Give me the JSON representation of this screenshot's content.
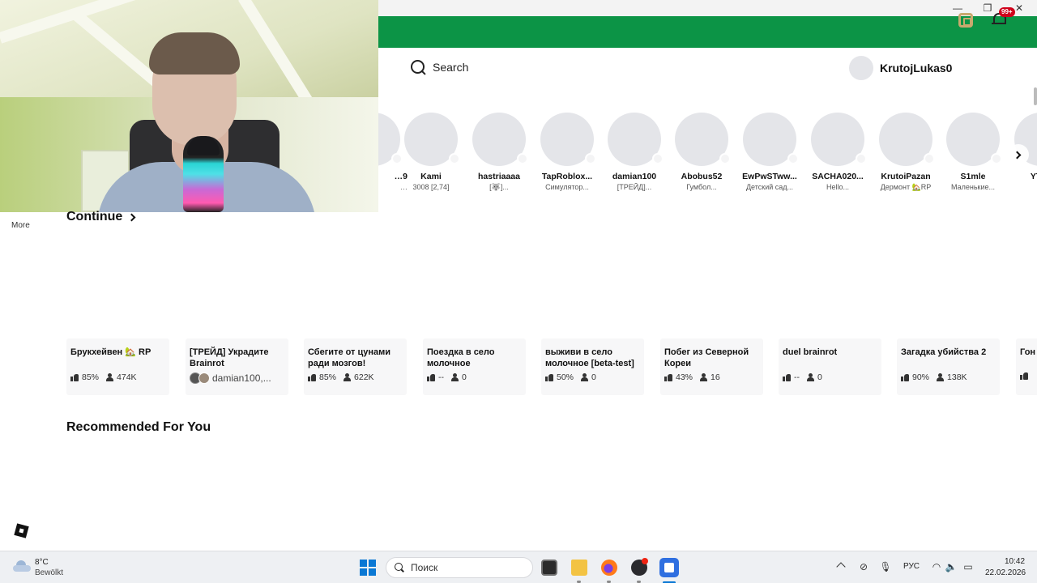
{
  "window": {
    "minimize": "—",
    "maximize": "❐",
    "close": "✕"
  },
  "header": {
    "search_label": "Search",
    "username": "KrutojLukas0",
    "notification_badge": "99+"
  },
  "friends": [
    {
      "name": "…9",
      "sub": "…"
    },
    {
      "name": "Kami",
      "sub": "3008 [2,74]"
    },
    {
      "name": "hastriaaaa",
      "sub": "[🐺]..."
    },
    {
      "name": "TapRoblox...",
      "sub": "Симулятор..."
    },
    {
      "name": "damian100",
      "sub": "[ТРЕЙД]..."
    },
    {
      "name": "Abobus52",
      "sub": "Гумбол..."
    },
    {
      "name": "EwPwSTww...",
      "sub": "Детский сад..."
    },
    {
      "name": "SACHA020...",
      "sub": "Hello..."
    },
    {
      "name": "KrutoiPazan",
      "sub": "Дермонт 🏡RP"
    },
    {
      "name": "S1mle",
      "sub": "Маленькие..."
    },
    {
      "name": "YTLo",
      "sub": "[..."
    }
  ],
  "left_nav": {
    "more_label": "More"
  },
  "continue": {
    "title": "Continue",
    "games": [
      {
        "name": "Брукхейвен 🏡 RP",
        "rating": "85%",
        "players": "474K",
        "type": "stats"
      },
      {
        "name": "[ТРЕЙД] Украдите Brainrot",
        "creator": "damian100,...",
        "type": "creator"
      },
      {
        "name": "Сбегите от цунами ради мозгов!",
        "rating": "85%",
        "players": "622K",
        "type": "stats"
      },
      {
        "name": "Поездка в село молочное",
        "rating": "--",
        "players": "0",
        "type": "stats"
      },
      {
        "name": "выживи в село молочное [beta-test]",
        "rating": "50%",
        "players": "0",
        "type": "stats"
      },
      {
        "name": "Побег из Северной Кореи",
        "rating": "43%",
        "players": "16",
        "type": "stats"
      },
      {
        "name": "duel brainrot",
        "rating": "--",
        "players": "0",
        "type": "stats"
      },
      {
        "name": "Загадка убийства 2",
        "rating": "90%",
        "players": "138K",
        "type": "stats"
      },
      {
        "name": "Гон гор",
        "rating": "",
        "players": "",
        "type": "stats"
      }
    ]
  },
  "recommended": {
    "title": "Recommended For You"
  },
  "taskbar": {
    "weather_temp": "8°C",
    "weather_desc": "Bewölkt",
    "search_placeholder": "Поиск",
    "language": "РУС",
    "time": "10:42",
    "date": "22.02.2026"
  }
}
